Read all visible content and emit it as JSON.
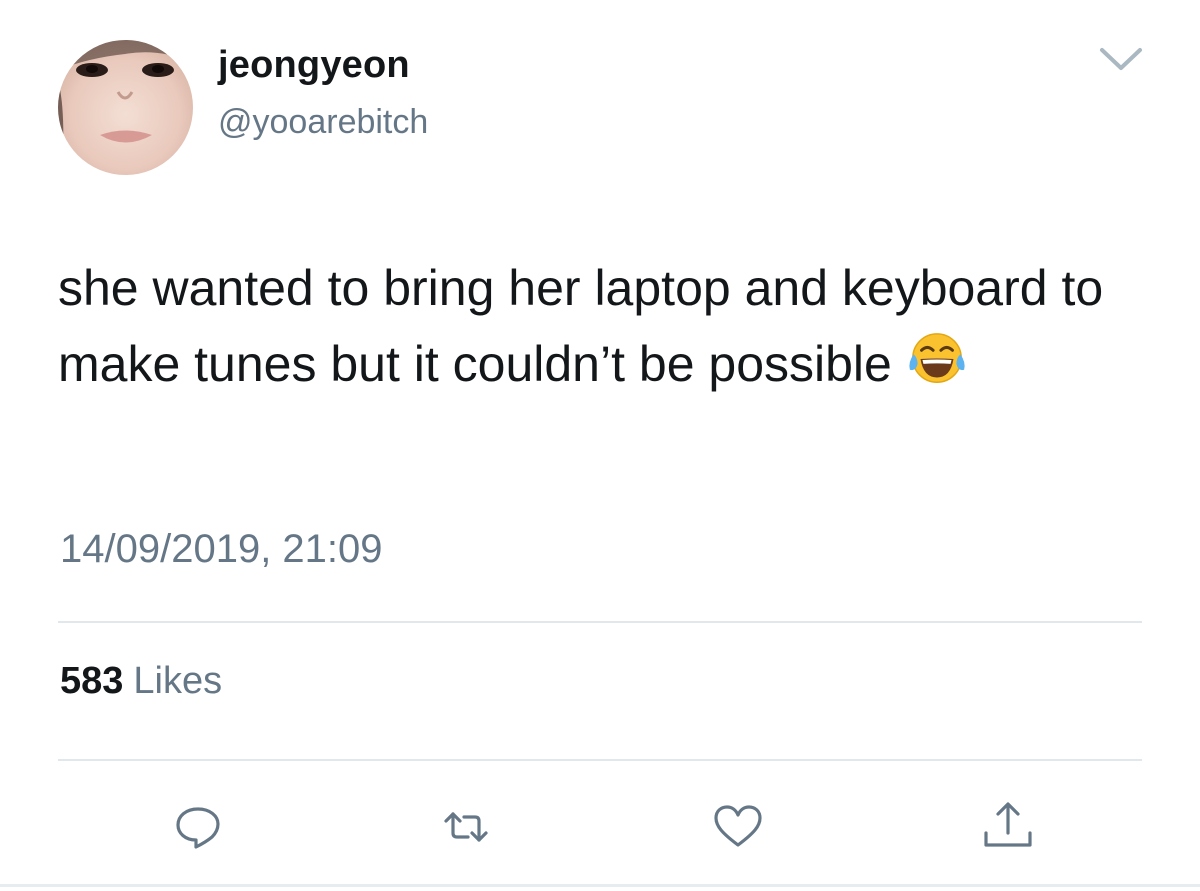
{
  "author": {
    "display_name": "jeongyeon",
    "handle": "@yooarebitch"
  },
  "tweet": {
    "text": "she wanted to bring her laptop and keyboard to make tunes but it couldn’t be possible",
    "emoji": "face-with-tears-of-joy",
    "timestamp": "14/09/2019, 21:09"
  },
  "stats": {
    "likes_count": "583",
    "likes_label": "Likes"
  },
  "actions": {
    "reply_icon": "speech-bubble-icon",
    "retweet_icon": "retweet-icon",
    "like_icon": "heart-icon",
    "share_icon": "share-icon"
  },
  "colors": {
    "primary_text": "#14171a",
    "secondary_text": "#657786",
    "divider": "#e1e8ed"
  }
}
